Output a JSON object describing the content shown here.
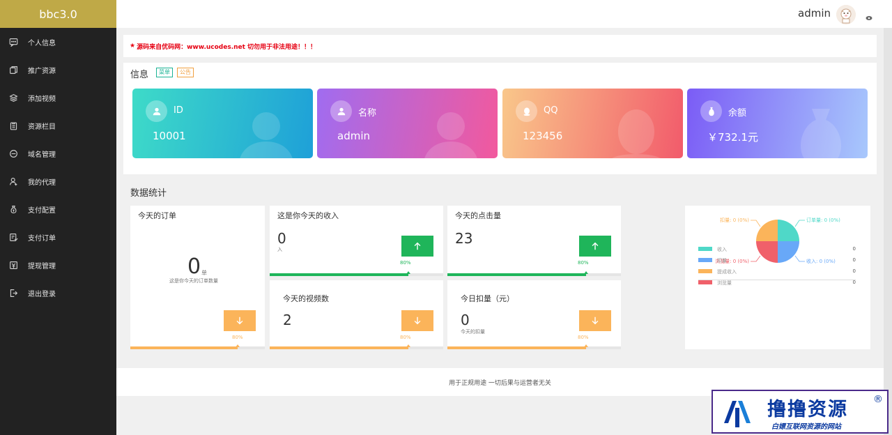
{
  "app": {
    "brand": "bbc3.0"
  },
  "sidebar": {
    "items": [
      {
        "label": "个人信息",
        "icon": "chat-icon"
      },
      {
        "label": "推广资源",
        "icon": "layers-icon"
      },
      {
        "label": "添加视频",
        "icon": "stack-icon"
      },
      {
        "label": "资源栏目",
        "icon": "clipboard-icon"
      },
      {
        "label": "域名管理",
        "icon": "domain-icon"
      },
      {
        "label": "我的代理",
        "icon": "user-icon"
      },
      {
        "label": "支付配置",
        "icon": "money-bag-icon"
      },
      {
        "label": "支付订单",
        "icon": "order-icon"
      },
      {
        "label": "提现管理",
        "icon": "withdraw-icon"
      },
      {
        "label": "退出登录",
        "icon": "logout-icon"
      }
    ]
  },
  "header": {
    "username": "admin"
  },
  "notice": {
    "text": "源码来自优码网：www.ucodes.net 切勿用于非法用途！！！"
  },
  "info": {
    "title": "信息",
    "tag1": "菜单",
    "tag2": "公告",
    "cards": [
      {
        "label": "ID",
        "value": "10001",
        "icon": "user-icon"
      },
      {
        "label": "名称",
        "value": "admin",
        "icon": "user-icon"
      },
      {
        "label": "QQ",
        "value": "123456",
        "icon": "qq-icon"
      },
      {
        "label": "余额",
        "value": "￥732.1元",
        "icon": "money-bag-icon"
      }
    ]
  },
  "stats": {
    "title": "数据统计",
    "orders": {
      "title": "今天的订单",
      "value": "0",
      "unit": "单",
      "sub": "这是你今天的订单数量",
      "pct": "80%",
      "fill": 0.8
    },
    "income": {
      "title": "这是你今天的收入",
      "value": "0",
      "sub": "入",
      "pct": "80%",
      "fill": 0.8
    },
    "clicks": {
      "title": "今天的点击量",
      "value": "23",
      "pct": "80%",
      "fill": 0.8
    },
    "videos": {
      "title": "今天的视频数",
      "value": "2",
      "pct": "80%",
      "fill": 0.8
    },
    "deduct": {
      "title": "今日扣量（元）",
      "value": "0",
      "sub": "今天的扣量",
      "pct": "80%",
      "fill": 0.8
    }
  },
  "chart_data": {
    "type": "pie",
    "slices": [
      {
        "label": "订单量",
        "value": 0,
        "pct": "0%",
        "color": "#4fd8c8"
      },
      {
        "label": "收入",
        "value": 0,
        "pct": "0%",
        "color": "#68a8f8"
      },
      {
        "label": "浏览量",
        "value": 0,
        "pct": "0%",
        "color": "#f0606a"
      },
      {
        "label": "扣量",
        "value": 0,
        "pct": "0%",
        "color": "#fbb45a"
      }
    ],
    "callouts": [
      "订单量: 0 (0%)",
      "收入: 0 (0%)",
      "浏览量: 0 (0%)",
      "扣量: 0 (0%)"
    ],
    "legend": [
      {
        "label": "收入",
        "value": "0",
        "color": "#4fd8c8"
      },
      {
        "label": "扣量",
        "value": "0",
        "color": "#68a8f8"
      },
      {
        "label": "提成收入",
        "value": "0",
        "color": "#fbb45a"
      },
      {
        "label": "浏览量",
        "value": "0",
        "color": "#f0606a"
      }
    ]
  },
  "footer": {
    "text": "用于正规用途 一切后果与运营者无关"
  },
  "watermark": {
    "title": "撸撸资源",
    "sub": "白嫖互联网资源的网站",
    "reg": "®"
  }
}
